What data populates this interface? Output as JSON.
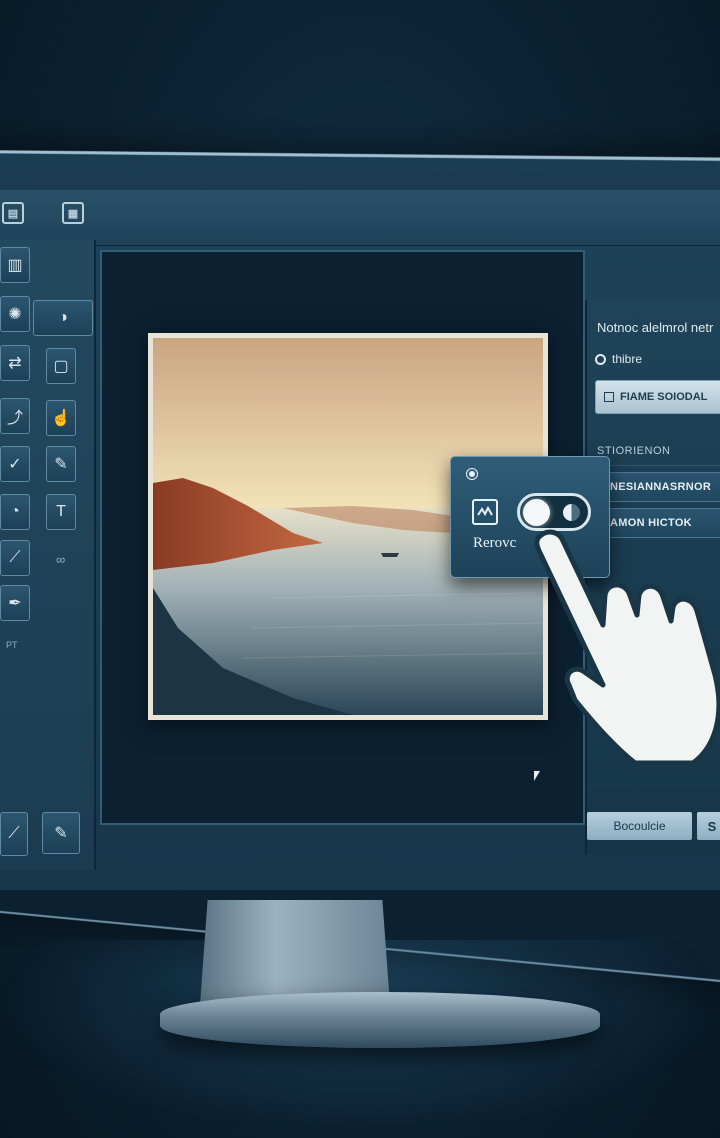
{
  "top_toolbar": {
    "buttons": [
      {
        "icon": "layers-icon",
        "glyph": "▤"
      },
      {
        "icon": "grid-icon",
        "glyph": "▦"
      }
    ]
  },
  "tool_panel": {
    "tools": [
      {
        "name": "bars-tool",
        "glyph": "▥"
      },
      {
        "name": "globe-tool",
        "glyph": "✺"
      },
      {
        "name": "moon-tool",
        "glyph": "◑"
      },
      {
        "name": "resize-tool",
        "glyph": "⇄"
      },
      {
        "name": "swatch-tool",
        "glyph": "▢"
      },
      {
        "name": "curve-tool",
        "glyph": "⤴"
      },
      {
        "name": "hand-tool",
        "glyph": "☝"
      },
      {
        "name": "check-tool",
        "glyph": "✓"
      },
      {
        "name": "brush-tool",
        "glyph": "✎"
      },
      {
        "name": "gauge-tool",
        "glyph": "◔"
      },
      {
        "name": "text-tool",
        "glyph": "T"
      },
      {
        "name": "pen-tool",
        "glyph": "⟋"
      },
      {
        "name": "feather-tool",
        "glyph": "✒"
      }
    ],
    "label_infinity": "∞",
    "label_small": "PT"
  },
  "right_panel": {
    "heading": "Notnoc alelmrol netr",
    "radio_label": "thibre",
    "field_label": "FIAME SOIODAL",
    "subheading": "STIORIENON",
    "items": [
      "NESIANNASRNOR",
      "AMON HICTOK"
    ],
    "bottom_button": "Bocoulcie",
    "bottom_button_2": "S"
  },
  "popup": {
    "label": "Rerovc",
    "toggle_state": "on"
  }
}
